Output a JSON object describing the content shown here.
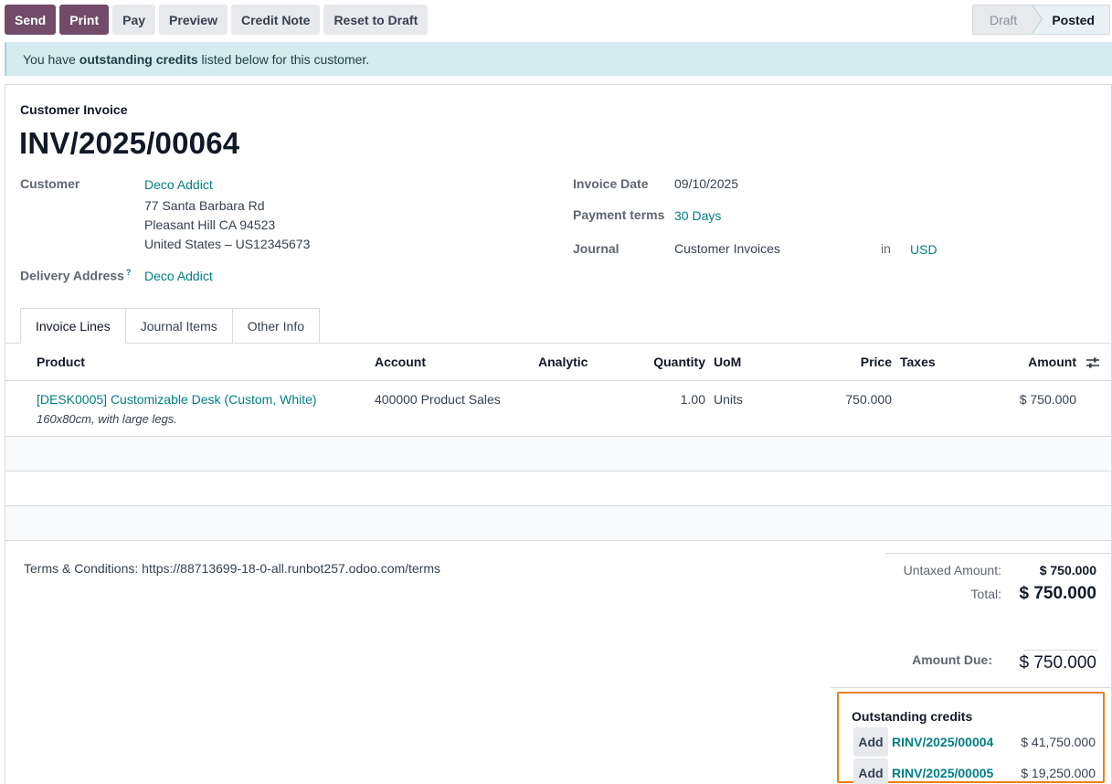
{
  "toolbar": {
    "send": "Send",
    "print": "Print",
    "pay": "Pay",
    "preview": "Preview",
    "credit_note": "Credit Note",
    "reset_to_draft": "Reset to Draft"
  },
  "status": {
    "draft": "Draft",
    "posted": "Posted",
    "current": "Posted"
  },
  "alert": {
    "prefix": "You have ",
    "bold": "outstanding credits",
    "suffix": " listed below for this customer."
  },
  "invoice": {
    "type": "Customer Invoice",
    "number": "INV/2025/00064",
    "customer_label": "Customer",
    "customer_name": "Deco Addict",
    "address_line1": "77 Santa Barbara Rd",
    "address_line2": "Pleasant Hill CA 94523",
    "address_line3": "United States – US12345673",
    "delivery_label": "Delivery Address",
    "delivery_help": "?",
    "delivery_value": "Deco Addict",
    "invoice_date_label": "Invoice Date",
    "invoice_date": "09/10/2025",
    "payment_terms_label": "Payment terms",
    "payment_terms": "30 Days",
    "journal_label": "Journal",
    "journal": "Customer Invoices",
    "in_label": "in",
    "currency": "USD"
  },
  "tabs": [
    "Invoice Lines",
    "Journal Items",
    "Other Info"
  ],
  "lines": {
    "headers": {
      "product": "Product",
      "account": "Account",
      "analytic": "Analytic",
      "quantity": "Quantity",
      "uom": "UoM",
      "price": "Price",
      "taxes": "Taxes",
      "amount": "Amount"
    },
    "rows": [
      {
        "product": "[DESK0005] Customizable Desk (Custom, White)",
        "description": "160x80cm, with large legs.",
        "account": "400000 Product Sales",
        "analytic": "",
        "quantity": "1.00",
        "uom": "Units",
        "price": "750.000",
        "taxes": "",
        "amount": "$ 750.000"
      }
    ]
  },
  "terms": "Terms & Conditions: https://88713699-18-0-all.runbot257.odoo.com/terms",
  "totals": {
    "untaxed_label": "Untaxed Amount:",
    "untaxed": "$ 750.000",
    "total_label": "Total:",
    "total": "$ 750.000",
    "due_label": "Amount Due:",
    "due": "$ 750.000"
  },
  "credits": {
    "title": "Outstanding credits",
    "add_label": "Add",
    "items": [
      {
        "ref": "RINV/2025/00004",
        "amount": "$ 41,750.000"
      },
      {
        "ref": "RINV/2025/00005",
        "amount": "$ 19,250.000"
      }
    ]
  },
  "colors": {
    "primary": "#714b67",
    "link": "#017e84",
    "highlight": "#e8801a",
    "alert_bg": "#d4ebf0"
  }
}
